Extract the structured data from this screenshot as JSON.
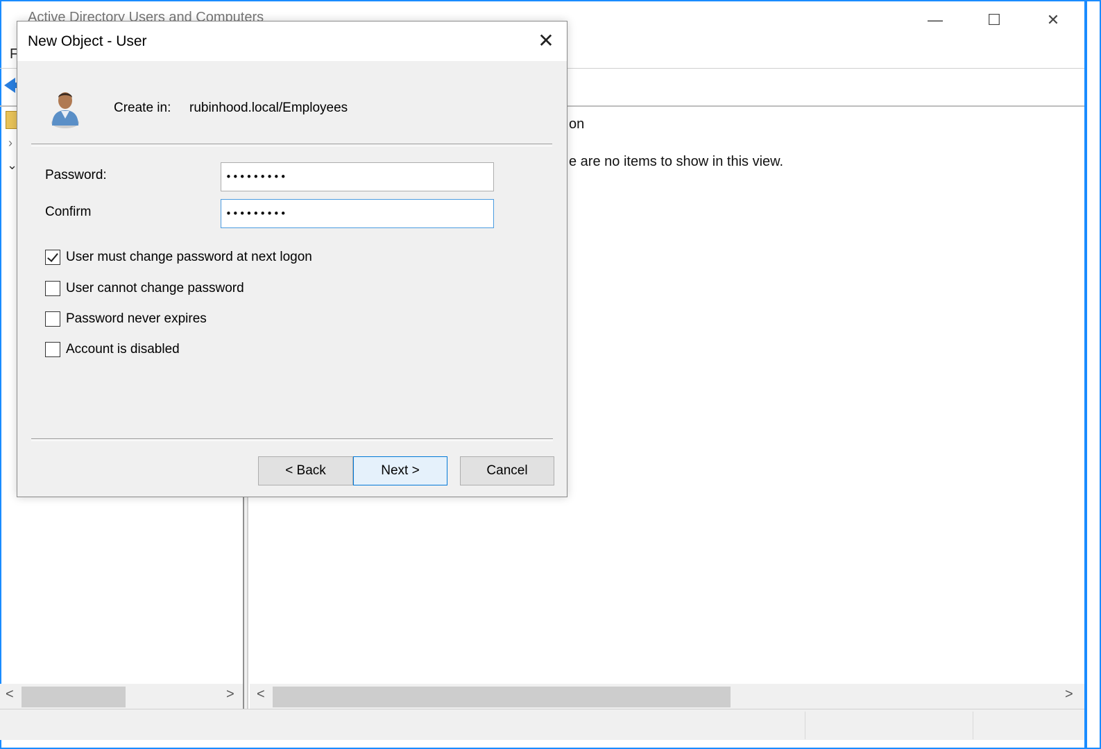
{
  "background_window": {
    "title": "Active Directory Users and Computers",
    "menu_first_letter": "F",
    "controls": {
      "minimize": "—",
      "maximize": "☐",
      "close": "✕"
    },
    "content_column_header": "on",
    "empty_message": "e are no items to show in this view."
  },
  "dialog": {
    "title": "New Object - User",
    "close_glyph": "✕",
    "create_in_label": "Create in:",
    "create_in_path": "rubinhood.local/Employees",
    "password_label": "Password:",
    "password_value": "•••••••••",
    "confirm_label": "Confirm",
    "confirm_value": "•••••••••",
    "options": [
      {
        "label": "User must change password at next logon",
        "checked": true
      },
      {
        "label": "User cannot change password",
        "checked": false
      },
      {
        "label": "Password never expires",
        "checked": false
      },
      {
        "label": "Account is disabled",
        "checked": false
      }
    ],
    "buttons": {
      "back": "< Back",
      "next": "Next >",
      "cancel": "Cancel"
    }
  },
  "colors": {
    "window_border": "#1a8cff",
    "dialog_bg": "#f0f0f0",
    "default_button_border": "#0078d7",
    "focus_border": "#4a9be0"
  }
}
